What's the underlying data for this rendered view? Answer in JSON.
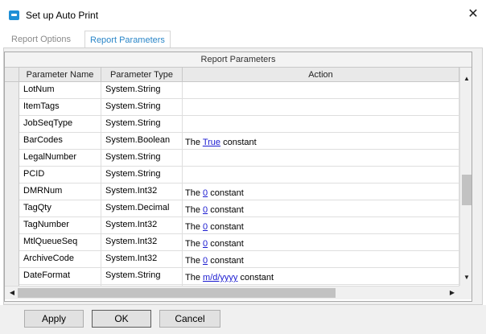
{
  "window": {
    "title": "Set up Auto Print",
    "close_glyph": "✕",
    "icon": "app-icon"
  },
  "tabs": [
    {
      "label": "Report Options",
      "active": false
    },
    {
      "label": "Report Parameters",
      "active": true
    }
  ],
  "grid": {
    "caption": "Report Parameters",
    "columns": [
      "Parameter Name",
      "Parameter Type",
      "Action"
    ],
    "rows": [
      {
        "name": "LotNum",
        "type": "System.String",
        "action": null
      },
      {
        "name": "ItemTags",
        "type": "System.String",
        "action": null
      },
      {
        "name": "JobSeqType",
        "type": "System.String",
        "action": null
      },
      {
        "name": "BarCodes",
        "type": "System.Boolean",
        "action": {
          "prefix": "The",
          "link": "True",
          "suffix": "constant"
        }
      },
      {
        "name": "LegalNumber",
        "type": "System.String",
        "action": null
      },
      {
        "name": "PCID",
        "type": "System.String",
        "action": null
      },
      {
        "name": "DMRNum",
        "type": "System.Int32",
        "action": {
          "prefix": "The",
          "link": "0",
          "suffix": "constant"
        }
      },
      {
        "name": "TagQty",
        "type": "System.Decimal",
        "action": {
          "prefix": "The",
          "link": "0",
          "suffix": "constant"
        }
      },
      {
        "name": "TagNumber",
        "type": "System.Int32",
        "action": {
          "prefix": "The",
          "link": "0",
          "suffix": "constant"
        }
      },
      {
        "name": "MtlQueueSeq",
        "type": "System.Int32",
        "action": {
          "prefix": "The",
          "link": "0",
          "suffix": "constant"
        }
      },
      {
        "name": "ArchiveCode",
        "type": "System.Int32",
        "action": {
          "prefix": "The",
          "link": "0",
          "suffix": "constant"
        }
      },
      {
        "name": "DateFormat",
        "type": "System.String",
        "action": {
          "prefix": "The",
          "link": "m/d/yyyy",
          "suffix": "constant"
        }
      },
      {
        "name": "",
        "type": "",
        "action": null
      }
    ]
  },
  "scroll": {
    "up": "▲",
    "down": "▼",
    "left": "◀",
    "right": "▶"
  },
  "buttons": {
    "apply": "Apply",
    "ok": "OK",
    "cancel": "Cancel"
  }
}
